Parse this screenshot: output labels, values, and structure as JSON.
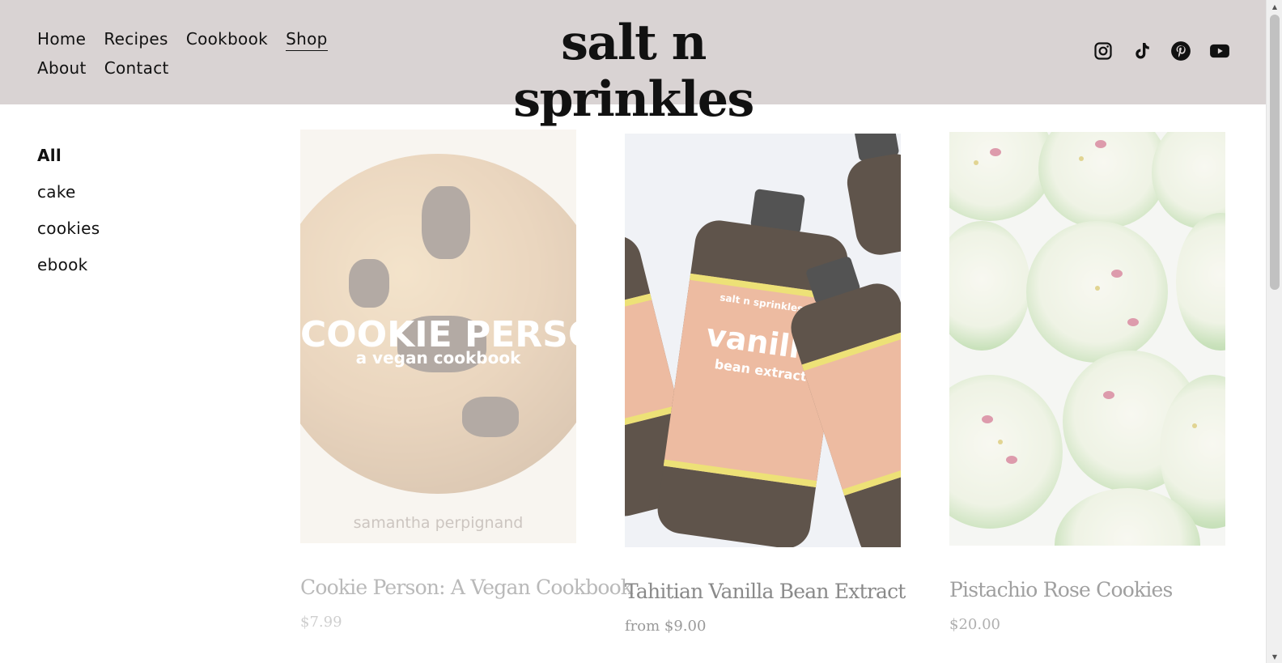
{
  "header": {
    "logo": "salt n sprinkles",
    "nav": [
      {
        "label": "Home",
        "active": false
      },
      {
        "label": "Recipes",
        "active": false
      },
      {
        "label": "Cookbook",
        "active": false
      },
      {
        "label": "Shop",
        "active": true
      },
      {
        "label": "About",
        "active": false
      },
      {
        "label": "Contact",
        "active": false
      }
    ],
    "social": [
      "instagram-icon",
      "tiktok-icon",
      "pinterest-icon",
      "youtube-icon"
    ]
  },
  "sidebar": {
    "categories": [
      {
        "label": "All",
        "active": true
      },
      {
        "label": "cake",
        "active": false
      },
      {
        "label": "cookies",
        "active": false
      },
      {
        "label": "ebook",
        "active": false
      }
    ]
  },
  "products": [
    {
      "title": "Cookie Person: A Vegan Cookbook",
      "price": "$7.99",
      "image": {
        "cover_title": "COOKIE PERSON",
        "cover_subtitle": "a vegan cookbook",
        "cover_author": "samantha perpignand"
      }
    },
    {
      "title": "Tahitian Vanilla Bean Extract",
      "price": "from $9.00",
      "image": {
        "label_brand": "salt n sprinkles",
        "label_name": "vanilla",
        "label_sub": "bean extract"
      }
    },
    {
      "title": "Pistachio Rose Cookies",
      "price": "$20.00"
    }
  ],
  "colors": {
    "header_bg": "#d9d3d3",
    "page_bg": "#ffffff",
    "text": "#111111"
  }
}
